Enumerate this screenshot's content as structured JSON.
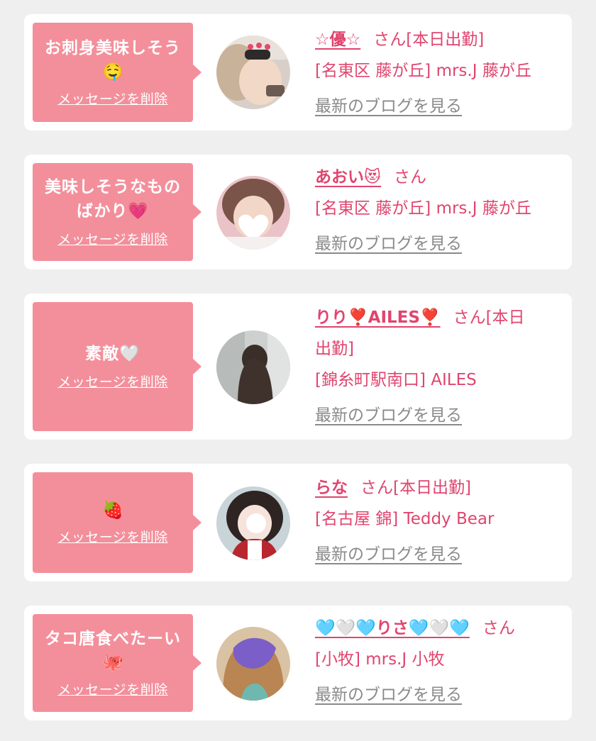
{
  "favorites": [
    {
      "message": "お刺身美味しそう",
      "message_emoji": "🤤",
      "delete_label": "メッセージを削除",
      "name": "☆優☆",
      "san": "さん",
      "status": "[本日出勤]",
      "shop": "[名東区 藤が丘] mrs.J 藤が丘",
      "blog_label": "最新のブログを見る"
    },
    {
      "message": "美味しそうなもの",
      "message_line2": "ばかり💗",
      "delete_label": "メッセージを削除",
      "name": "あおい😻",
      "san": "さん",
      "status": "",
      "shop": "[名東区 藤が丘] mrs.J 藤が丘",
      "blog_label": "最新のブログを見る"
    },
    {
      "message": "素敵🤍",
      "delete_label": "メッセージを削除",
      "name": "りり❣️AILES❣️",
      "san": "さん",
      "status_line1": "[本日",
      "status_line2": "出勤]",
      "shop": "[錦糸町駅南口] AILES",
      "blog_label": "最新のブログを見る"
    },
    {
      "message_emoji": "🍓",
      "delete_label": "メッセージを削除",
      "name": "らな",
      "san": "さん",
      "status": "[本日出勤]",
      "shop": "[名古屋 錦] Teddy Bear",
      "blog_label": "最新のブログを見る"
    },
    {
      "message": "タコ唐食べたーい",
      "message_emoji": "🐙",
      "delete_label": "メッセージを削除",
      "name": "🩵🤍🩵りさ🩵🤍🩵",
      "san": "さん",
      "status": "",
      "shop": "[小牧] mrs.J 小牧",
      "blog_label": "最新のブログを見る"
    }
  ],
  "colors": {
    "page_background": "#efefef",
    "card_background": "#ffffff",
    "bubble_pink": "#f38f9b",
    "accent_text": "#e0456e",
    "link_gray": "#8a8a8a"
  }
}
